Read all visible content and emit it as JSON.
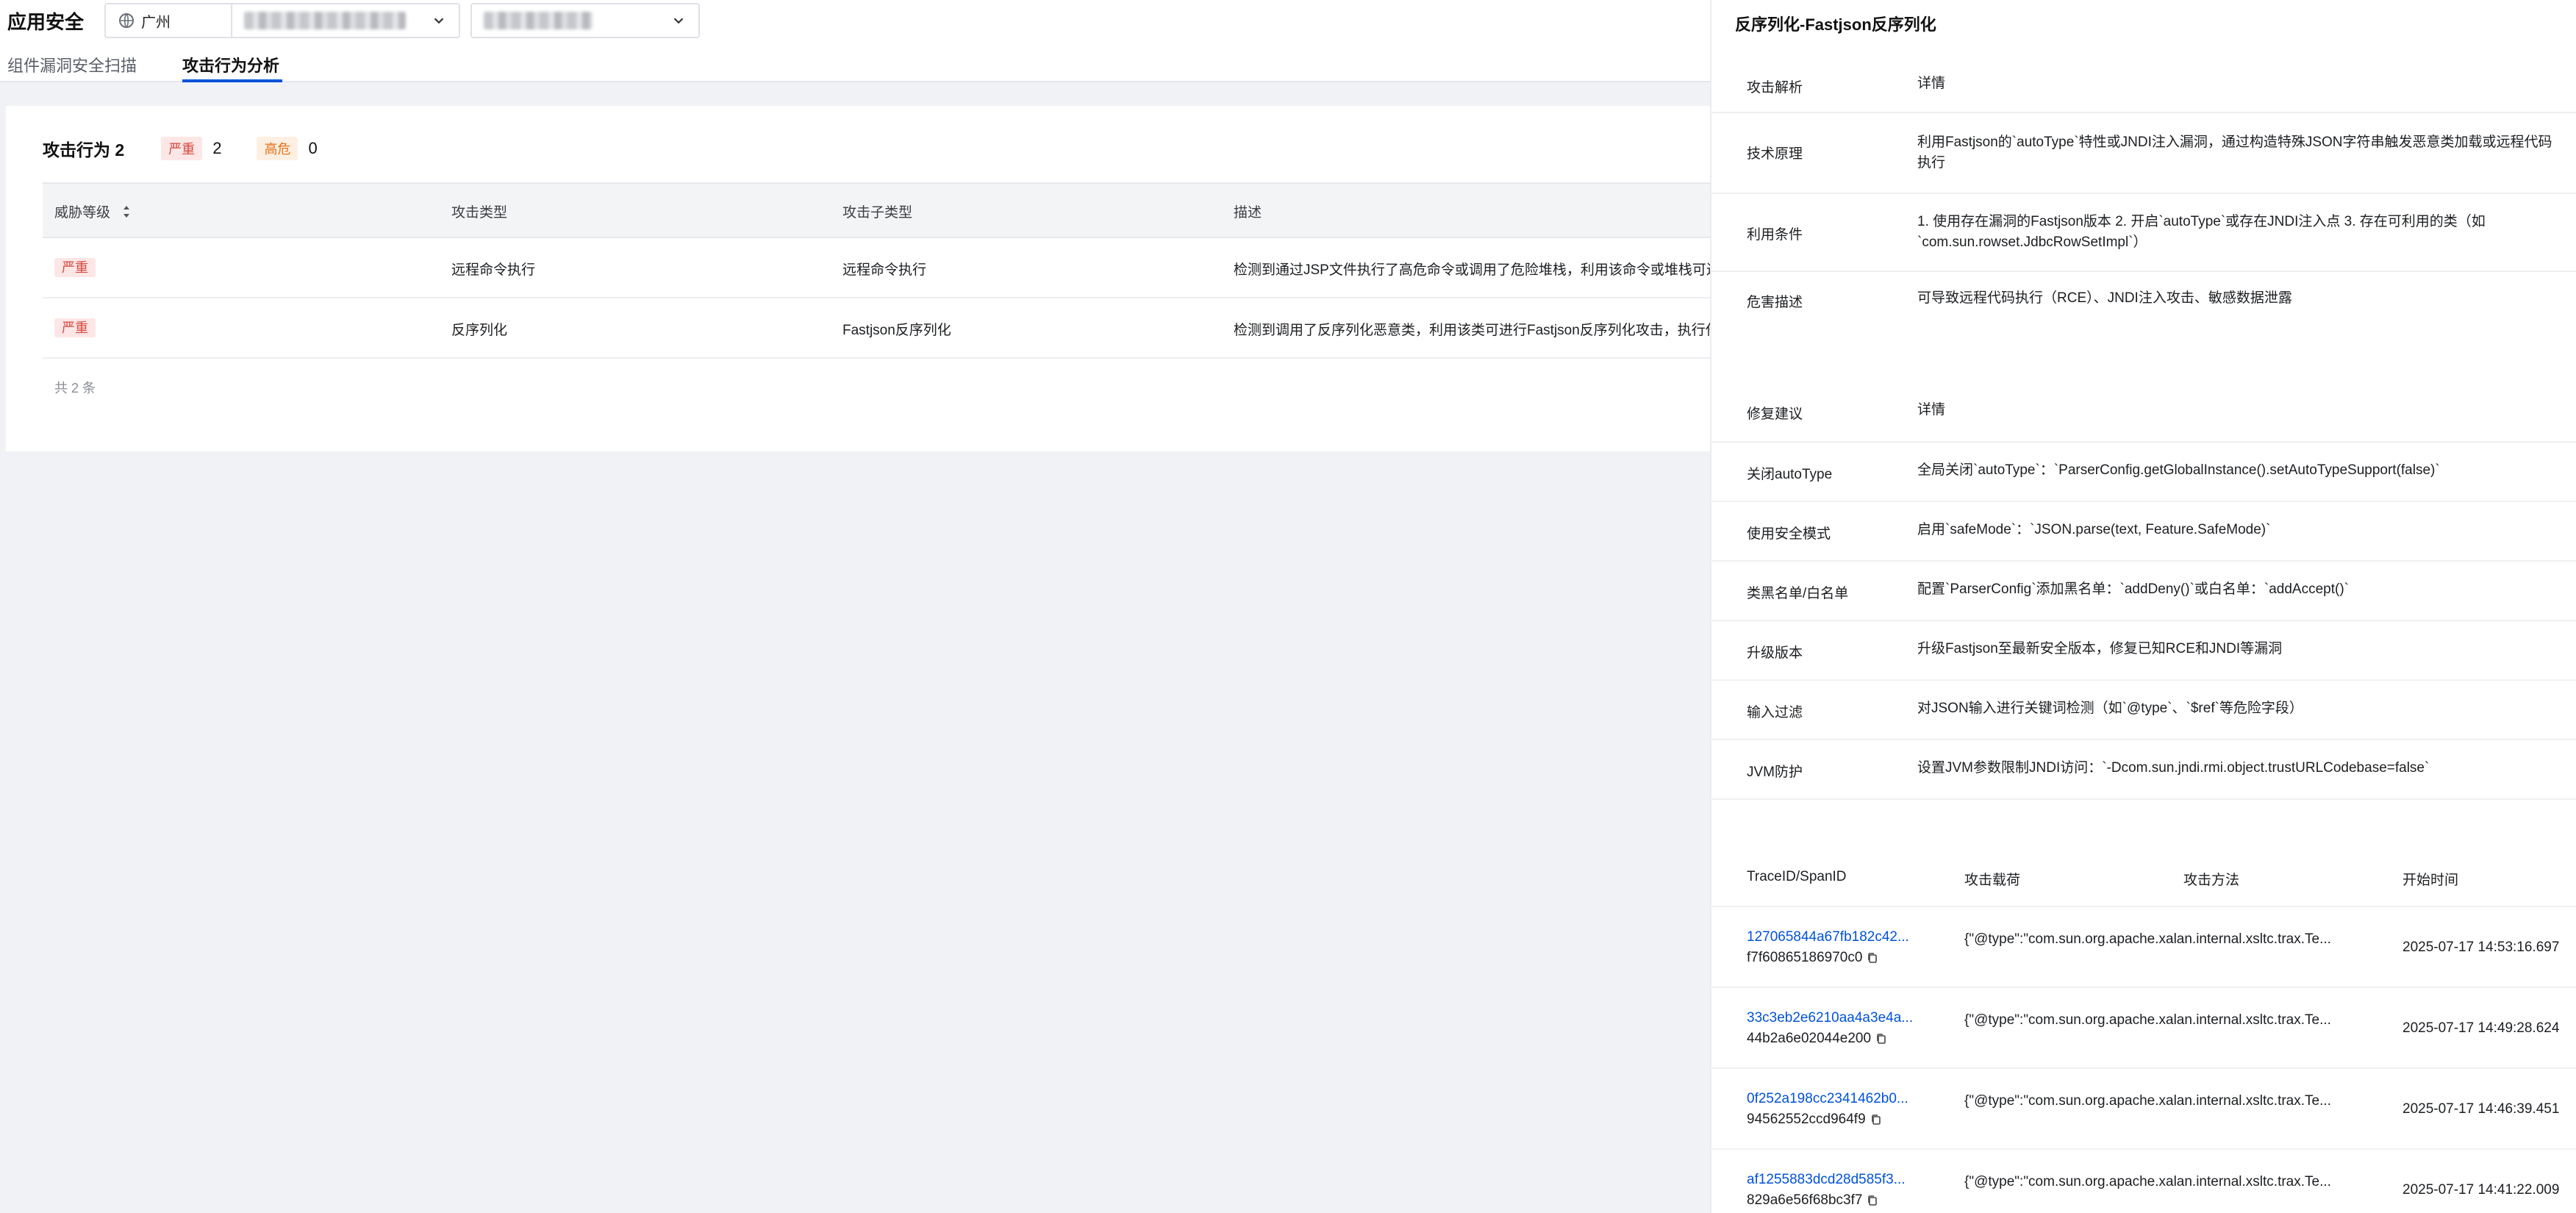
{
  "app": {
    "title": "应用安全"
  },
  "filters": {
    "region": "广州"
  },
  "tabs": [
    {
      "label": "组件漏洞安全扫描"
    },
    {
      "label": "攻击行为分析"
    }
  ],
  "summary": {
    "title": "攻击行为 2",
    "severe_label": "严重",
    "severe_count": "2",
    "high_label": "高危",
    "high_count": "0"
  },
  "table": {
    "columns": [
      "威胁等级",
      "攻击类型",
      "攻击子类型",
      "描述"
    ],
    "rows": [
      {
        "level": "严重",
        "type": "远程命令执行",
        "subtype": "远程命令执行",
        "desc": "检测到通过JSP文件执行了高危命令或调用了危险堆栈，利用该命令或堆栈可进"
      },
      {
        "level": "严重",
        "type": "反序列化",
        "subtype": "Fastjson反序列化",
        "desc": "检测到调用了反序列化恶意类，利用该类可进行Fastjson反序列化攻击，执行任"
      }
    ],
    "total": "共 2 条"
  },
  "drawer": {
    "title": "反序列化-Fastjson反序列化",
    "analysis": {
      "header": [
        "攻击解析",
        "详情"
      ],
      "rows": [
        {
          "k": "技术原理",
          "v": "利用Fastjson的`autoType`特性或JNDI注入漏洞，通过构造特殊JSON字符串触发恶意类加载或远程代码执行"
        },
        {
          "k": "利用条件",
          "v": "1. 使用存在漏洞的Fastjson版本 2. 开启`autoType`或存在JNDI注入点 3. 存在可利用的类（如`com.sun.rowset.JdbcRowSetImpl`）"
        },
        {
          "k": "危害描述",
          "v": "可导致远程代码执行（RCE）、JNDI注入攻击、敏感数据泄露"
        }
      ]
    },
    "fix": {
      "header": [
        "修复建议",
        "详情"
      ],
      "rows": [
        {
          "k": "关闭autoType",
          "v": "全局关闭`autoType`：`ParserConfig.getGlobalInstance().setAutoTypeSupport(false)`"
        },
        {
          "k": "使用安全模式",
          "v": "启用`safeMode`：`JSON.parse(text, Feature.SafeMode)`"
        },
        {
          "k": "类黑名单/白名单",
          "v": "配置`ParserConfig`添加黑名单：`addDeny()`或白名单：`addAccept()`"
        },
        {
          "k": "升级版本",
          "v": "升级Fastjson至最新安全版本，修复已知RCE和JNDI等漏洞"
        },
        {
          "k": "输入过滤",
          "v": "对JSON输入进行关键词检测（如`@type`、`$ref`等危险字段）"
        },
        {
          "k": "JVM防护",
          "v": "设置JVM参数限制JNDI访问：`-Dcom.sun.jndi.rmi.object.trustURLCodebase=false`"
        }
      ]
    },
    "traces": {
      "columns": [
        "TraceID/SpanID",
        "攻击载荷",
        "攻击方法",
        "开始时间"
      ],
      "rows": [
        {
          "trace": "127065844a67fb182c42...",
          "span": "f7f60865186970c0",
          "payload": "{\"@type\":\"com.sun.org.apache.xalan.internal.xsltc.trax.Te...",
          "method": "",
          "time": "2025-07-17 14:53:16.697"
        },
        {
          "trace": "33c3eb2e6210aa4a3e4a...",
          "span": "44b2a6e02044e200",
          "payload": "{\"@type\":\"com.sun.org.apache.xalan.internal.xsltc.trax.Te...",
          "method": "",
          "time": "2025-07-17 14:49:28.624"
        },
        {
          "trace": "0f252a198cc2341462b0...",
          "span": "94562552ccd964f9",
          "payload": "{\"@type\":\"com.sun.org.apache.xalan.internal.xsltc.trax.Te...",
          "method": "",
          "time": "2025-07-17 14:46:39.451"
        },
        {
          "trace": "af1255883dcd28d585f3...",
          "span": "829a6e56f68bc3f7",
          "payload": "{\"@type\":\"com.sun.org.apache.xalan.internal.xsltc.trax.Te...",
          "method": "",
          "time": "2025-07-17 14:41:22.009"
        }
      ]
    }
  },
  "colors": {
    "accent": "#0052d9",
    "severe_bg": "#fde7e6",
    "severe_fg": "#d54941",
    "high_bg": "#fdf0e3",
    "high_fg": "#e37318"
  }
}
